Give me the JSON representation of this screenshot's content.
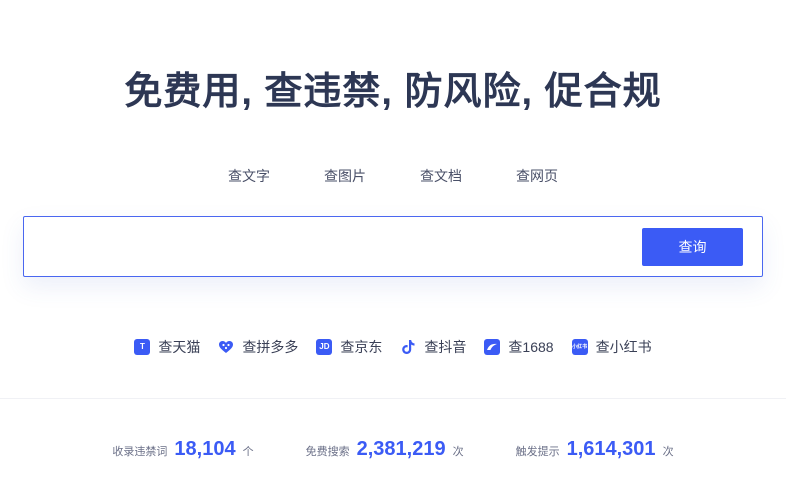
{
  "hero": {
    "title": "免费用, 查违禁, 防风险, 促合规"
  },
  "tabs": [
    {
      "label": "查文字"
    },
    {
      "label": "查图片"
    },
    {
      "label": "查文档"
    },
    {
      "label": "查网页"
    }
  ],
  "search": {
    "value": "",
    "placeholder": "",
    "button_label": "查询"
  },
  "platforms": [
    {
      "label": "查天猫",
      "icon": "tmall-icon",
      "glyph": "T"
    },
    {
      "label": "查拼多多",
      "icon": "pinduoduo-icon",
      "glyph": ""
    },
    {
      "label": "查京东",
      "icon": "jd-icon",
      "glyph": "JD"
    },
    {
      "label": "查抖音",
      "icon": "douyin-icon",
      "glyph": ""
    },
    {
      "label": "查1688",
      "icon": "alibaba-1688-icon",
      "glyph": ""
    },
    {
      "label": "查小红书",
      "icon": "xiaohongshu-icon",
      "glyph": "小红书"
    }
  ],
  "stats": [
    {
      "label": "收录违禁词",
      "value": "18,104",
      "unit": "个"
    },
    {
      "label": "免费搜索",
      "value": "2,381,219",
      "unit": "次"
    },
    {
      "label": "触发提示",
      "value": "1,614,301",
      "unit": "次"
    }
  ],
  "colors": {
    "accent": "#3b5bf5",
    "title": "#2d3754",
    "border": "#4a67f0"
  }
}
